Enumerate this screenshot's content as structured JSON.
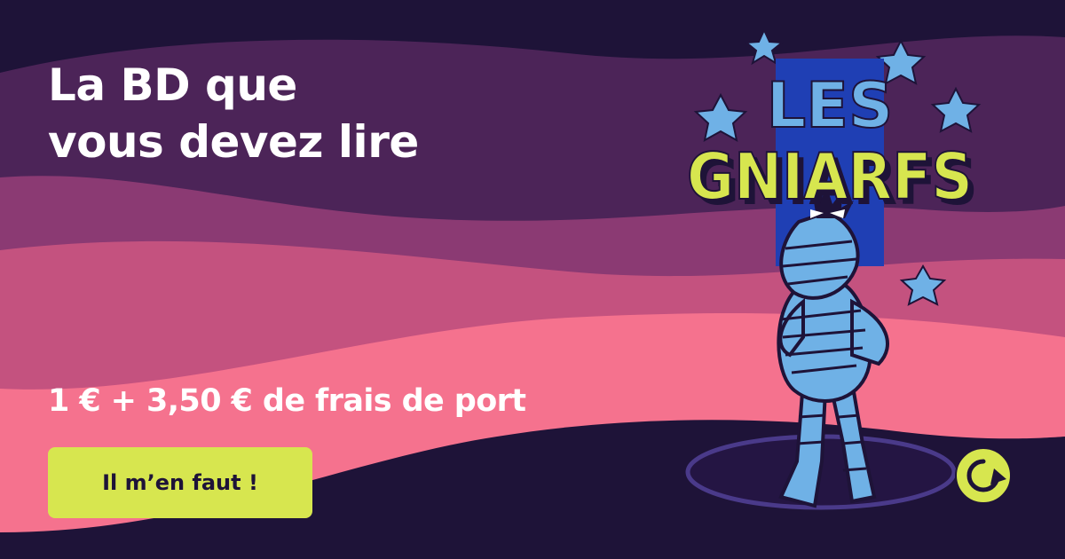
{
  "headline": {
    "line1": "La BD que",
    "line2": "vous devez lire"
  },
  "price": "1 € + 3,50 € de frais de port",
  "cta": {
    "label": "Il m’en faut !"
  },
  "logo": {
    "line1": "LES",
    "line2": "GNIARFS"
  },
  "icons": {
    "refresh": "refresh-arrow-icon",
    "stars": "star-icon"
  },
  "colors": {
    "background": "#1e1338",
    "wave_dark": "#4c2458",
    "wave_mid": "#8b3a73",
    "wave_rose": "#c4527f",
    "wave_pink": "#f5728e",
    "accent_lime": "#d7e64f",
    "logo_blue": "#1f3fb4",
    "star_blue": "#6fb1e6",
    "text": "#ffffff"
  }
}
